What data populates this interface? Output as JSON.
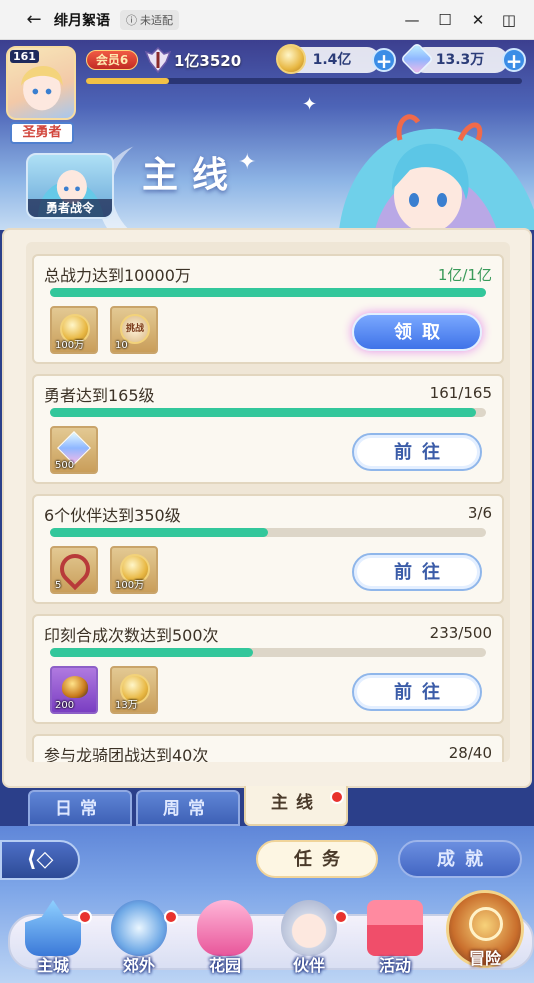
{
  "window": {
    "title": "绯月絮语",
    "badge": "未适配",
    "back_icon": "←",
    "min_icon": "—",
    "max_icon": "☐",
    "close_icon": "✕",
    "side_icon": "◫"
  },
  "player": {
    "level": "161",
    "rank": "圣勇者",
    "vip": "会员6",
    "power": "1亿3520",
    "exp_fraction": 0.19
  },
  "resources": {
    "gold": "1.4亿",
    "diamond": "13.3万",
    "plus": "+"
  },
  "header": {
    "pass_label": "勇者战令",
    "title": "主线"
  },
  "quests": [
    {
      "title": "总战力达到10000万",
      "progress": "1亿/1亿",
      "fraction": 1.0,
      "done": true,
      "rewards": [
        {
          "icon": "gold-coin",
          "qty": "100万"
        },
        {
          "icon": "challenge-badge",
          "qty": "10",
          "text": "挑战"
        }
      ],
      "button": "领取"
    },
    {
      "title": "勇者达到165级",
      "progress": "161/165",
      "fraction": 0.976,
      "done": false,
      "rewards": [
        {
          "icon": "diamond-crystal",
          "qty": "500"
        }
      ],
      "button": "前往"
    },
    {
      "title": "6个伙伴达到350级",
      "progress": "3/6",
      "fraction": 0.5,
      "done": false,
      "rewards": [
        {
          "icon": "heart-bow",
          "qty": "5"
        },
        {
          "icon": "gold-coin",
          "qty": "100万"
        }
      ],
      "button": "前往"
    },
    {
      "title": "印刻合成次数达到500次",
      "progress": "233/500",
      "fraction": 0.466,
      "done": false,
      "rewards": [
        {
          "icon": "imprint-stone",
          "qty": "200"
        },
        {
          "icon": "gold-coin",
          "qty": "13万"
        }
      ],
      "button": "前往"
    },
    {
      "title": "参与龙骑团战达到40次",
      "progress": "28/40",
      "fraction": 0.7,
      "done": false,
      "rewards": [],
      "button": ""
    }
  ],
  "tabs": {
    "daily": "日常",
    "weekly": "周常",
    "main": "主线"
  },
  "modes": {
    "back": "⟨◇",
    "task": "任务",
    "achievement": "成就"
  },
  "nav": {
    "city": "主城",
    "outskirts": "郊外",
    "garden": "花园",
    "partner": "伙伴",
    "event": "活动",
    "adventure": "冒险"
  },
  "colors": {
    "progress": "#33c79b",
    "claim": "#3f73e8",
    "reddot": "#e8322e",
    "done_text": "#3a9a5a"
  }
}
